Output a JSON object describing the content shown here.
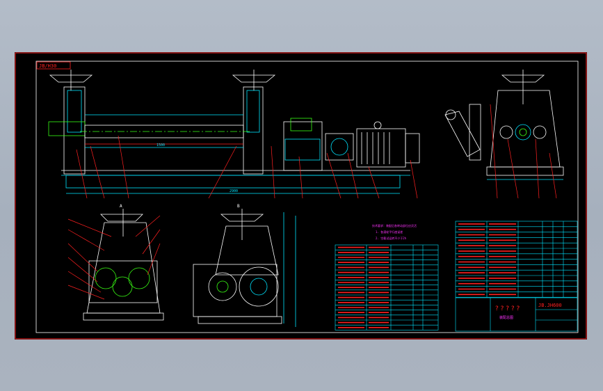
{
  "drawing": {
    "tag_top_left": "JB/H30",
    "title_question": "? ? ? ? ?",
    "drawing_code": "JB.JH600",
    "subtitle": "装配总图",
    "view_label_a": "A",
    "view_label_b": "B",
    "dim_total_length": "2900",
    "dim_roll_length": "1500"
  },
  "notes": {
    "lines": [
      "技术要求：装配后各转动部位应灵活",
      "1. 各滚轮平行度误差",
      "2. 空载试运转不少于2h"
    ]
  },
  "colors": {
    "outer_bg": "#a9b2bf",
    "sheet_bg": "#000000",
    "border": "#d81e1e",
    "line_white": "#ffffff",
    "line_cyan": "#00e5ff",
    "line_green": "#39ff14",
    "line_yellow": "#ffff33",
    "line_red": "#ff2020",
    "line_magenta": "#ff33ff"
  }
}
